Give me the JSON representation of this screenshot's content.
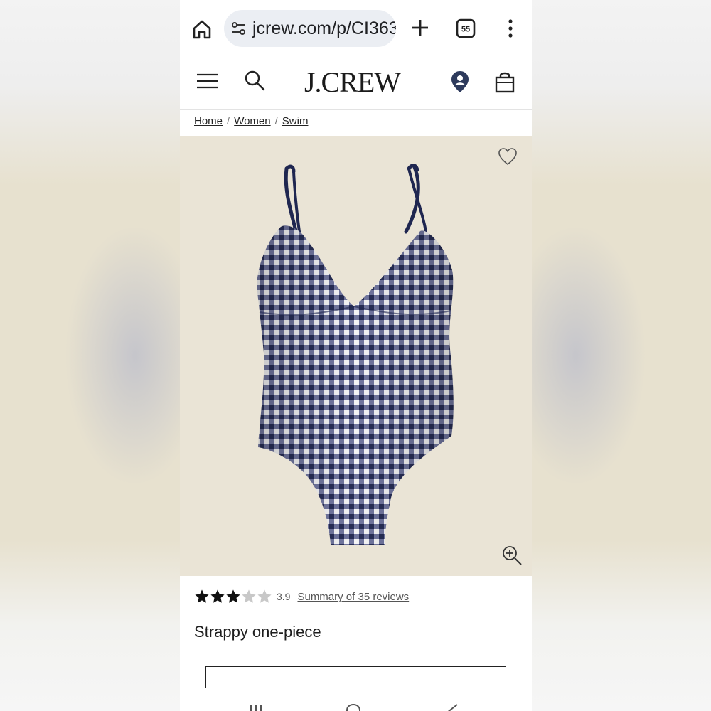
{
  "browser": {
    "url": "jcrew.com/p/CI363",
    "icons": [
      "home-icon",
      "site-settings-icon",
      "new-tab-plus-icon",
      "tab-switcher-icon",
      "more-menu-icon"
    ],
    "tab_count": "55"
  },
  "header": {
    "logo": "J.CREW",
    "icons": [
      "hamburger-menu-icon",
      "search-icon",
      "store-locator-pin-icon",
      "shopping-bag-icon"
    ]
  },
  "breadcrumb": {
    "items": [
      "Home",
      "Women",
      "Swim"
    ],
    "separator": "/"
  },
  "product": {
    "image_alt_icons": [
      "wishlist-heart-icon",
      "zoom-in-icon"
    ],
    "rating_value": 3.9,
    "rating_text": "3.9",
    "stars_total": 5,
    "reviews_link": "Summary of 35 reviews",
    "title": "Strappy one-piece"
  },
  "colors": {
    "gingham_navy": "#2d3561",
    "image_background": "#eae4d6",
    "text_primary": "#1e1e1e",
    "star_filled": "#111111",
    "star_empty": "#c8c8c8"
  }
}
